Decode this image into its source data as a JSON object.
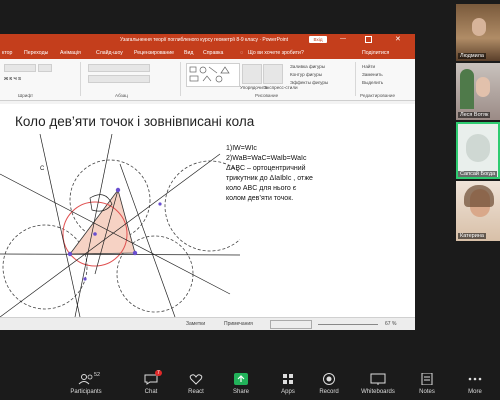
{
  "window": {
    "title": "Узагальнення теорії поглибленого курсу геометрії 8-9 класу  ·  PowerPoint",
    "search_hint": "Що ви хочете зробити?",
    "share_label": "Вхід",
    "share_button": "Поділитися"
  },
  "ribbon_tabs": [
    "ктор",
    "Переходы",
    "Анімація",
    "Слайд-шоу",
    "Рецензирование",
    "Вид",
    "Справка"
  ],
  "ribbon_groups": {
    "font": "Шрифт",
    "paragraph": "Абзац",
    "drawing": "Рисование",
    "editing": "Редактирование"
  },
  "ribbon_items": {
    "fill": "Заливка фигуры",
    "outline": "Контур фигуры",
    "effects": "Эффекты фигуры",
    "arrange": "Упорядочить",
    "styles": "Экспресс-стили",
    "find": "Найти",
    "replace": "Заменить",
    "select": "Выделить"
  },
  "slide": {
    "title": "Коло дев’яти точок і зовнівписані кола",
    "lines": [
      "1)IW=WIc",
      "2)WaB=WaC=WaIb=WaIc",
      "ΔABC – ортоцентричний",
      "трикутник до ΔIaIbIc , отже",
      "коло ABC для нього є",
      "колом дев’яти точок."
    ],
    "point_label": "C"
  },
  "status": {
    "notes": "Заметки",
    "comments": "Примечания",
    "zoom": "67 %"
  },
  "participants": [
    {
      "name": "Людмила"
    },
    {
      "name": "Леся Вотяк"
    },
    {
      "name": "Сапсай Богда"
    },
    {
      "name": "Катерина"
    }
  ],
  "toolbar": {
    "participants_count": "52",
    "chat_badge": "7",
    "items": [
      {
        "label": "Participants",
        "icon": "participants-icon"
      },
      {
        "label": "Chat",
        "icon": "chat-icon"
      },
      {
        "label": "React",
        "icon": "heart-icon"
      },
      {
        "label": "Share",
        "icon": "share-icon"
      },
      {
        "label": "Apps",
        "icon": "apps-icon"
      },
      {
        "label": "Record",
        "icon": "record-icon"
      },
      {
        "label": "Whiteboards",
        "icon": "whiteboard-icon"
      },
      {
        "label": "Notes",
        "icon": "notes-icon"
      },
      {
        "label": "More",
        "icon": "more-icon"
      }
    ]
  },
  "colors": {
    "ppt_accent": "#c43e1c",
    "share_green": "#22b25a",
    "record_red": "#e02828",
    "active_tile": "#2ecc71"
  }
}
